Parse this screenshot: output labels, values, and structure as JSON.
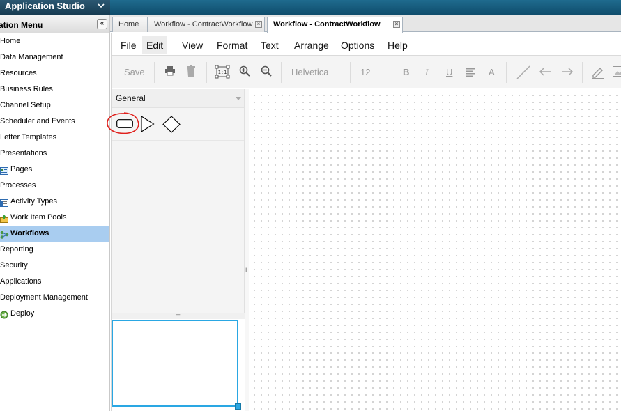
{
  "header": {
    "title": "Application Studio"
  },
  "sidebar": {
    "title": "ation Menu",
    "collapse_symbol": "«",
    "items": [
      {
        "label": "Home",
        "icon": "",
        "active": false
      },
      {
        "label": "Data Management",
        "icon": "",
        "active": false
      },
      {
        "label": "Resources",
        "icon": "",
        "active": false
      },
      {
        "label": "Business Rules",
        "icon": "",
        "active": false
      },
      {
        "label": "Channel Setup",
        "icon": "",
        "active": false
      },
      {
        "label": "Scheduler and Events",
        "icon": "",
        "active": false
      },
      {
        "label": "Letter Templates",
        "icon": "",
        "active": false
      },
      {
        "label": "Presentations",
        "icon": "",
        "active": false
      },
      {
        "label": "Pages",
        "icon": "pages-icon",
        "active": false
      },
      {
        "label": "Processes",
        "icon": "",
        "active": false
      },
      {
        "label": "Activity Types",
        "icon": "activity-types-icon",
        "active": false
      },
      {
        "label": "Work Item Pools",
        "icon": "work-item-pools-icon",
        "active": false
      },
      {
        "label": "Workflows",
        "icon": "workflows-icon",
        "active": true
      },
      {
        "label": "Reporting",
        "icon": "",
        "active": false
      },
      {
        "label": "Security",
        "icon": "",
        "active": false
      },
      {
        "label": "Applications",
        "icon": "",
        "active": false
      },
      {
        "label": "Deployment Management",
        "icon": "",
        "active": false
      },
      {
        "label": "Deploy",
        "icon": "deploy-icon",
        "active": false
      }
    ]
  },
  "tabs": [
    {
      "label": "Home",
      "closable": false,
      "active": false
    },
    {
      "label": "Workflow - ContractWorkflow",
      "closable": true,
      "active": false
    },
    {
      "label": "Workflow - ContractWorkflow",
      "closable": true,
      "active": true
    }
  ],
  "menubar": [
    "File",
    "Edit",
    "View",
    "Format",
    "Text",
    "Arrange",
    "Options",
    "Help"
  ],
  "toolbar": {
    "save_label": "Save",
    "font_family": "Helvetica",
    "font_size": "12",
    "bold": "B",
    "italic": "I",
    "underline": "U",
    "font_color": "A",
    "actual_size": "1:1"
  },
  "palette": {
    "title": "General"
  },
  "colors": {
    "accent": "#2aa7e3",
    "active_item": "#a9cdf0",
    "header": "#163a50",
    "annotation": "#e0201c"
  }
}
